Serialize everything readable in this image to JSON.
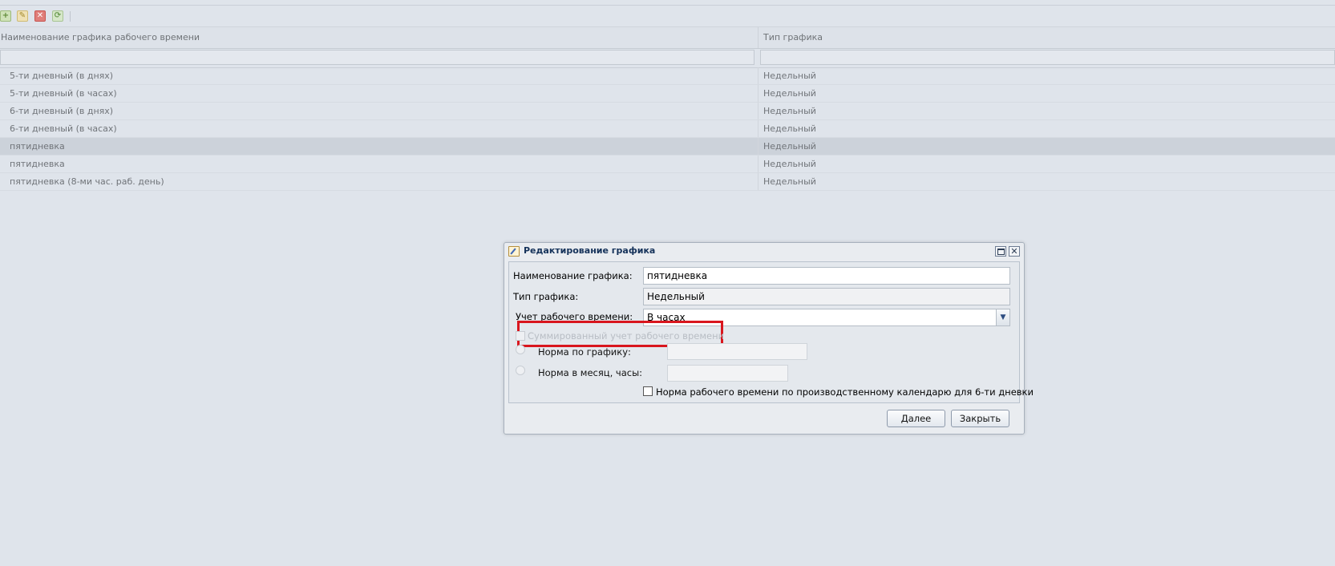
{
  "toolbar": {
    "add_icon": "+",
    "edit_icon": "✎",
    "delete_icon": "✕",
    "refresh_icon": "⟳"
  },
  "grid": {
    "columns": [
      "Наименование графика рабочего времени",
      "Тип графика"
    ],
    "rows": [
      {
        "name": "5-ти дневный (в днях)",
        "type": "Недельный"
      },
      {
        "name": "5-ти дневный (в часах)",
        "type": "Недельный"
      },
      {
        "name": "6-ти дневный (в днях)",
        "type": "Недельный"
      },
      {
        "name": "6-ти дневный (в часах)",
        "type": "Недельный"
      },
      {
        "name": "пятидневка",
        "type": "Недельный",
        "selected": true
      },
      {
        "name": "пятидневка",
        "type": "Недельный"
      },
      {
        "name": "пятидневка (8-ми час. раб. день)",
        "type": "Недельный"
      }
    ]
  },
  "dialog": {
    "title": "Редактирование графика",
    "name_label": "Наименование графика:",
    "name_value": "пятидневка",
    "type_label": "Тип графика:",
    "type_value": "Недельный",
    "accounting_label": "Учет рабочего времени:",
    "accounting_value": "В часах",
    "summed_label": "Суммированный учет рабочего времени",
    "norm_schedule_label": "Норма по графику:",
    "norm_month_label": "Норма в месяц, часы:",
    "calendar_checkbox_label": "Норма рабочего времени по производственному календарю для 6-ти дневки",
    "next_button": "Далее",
    "close_button": "Закрыть"
  },
  "colors": {
    "highlight": "#d9161e",
    "title": "#15325a"
  }
}
